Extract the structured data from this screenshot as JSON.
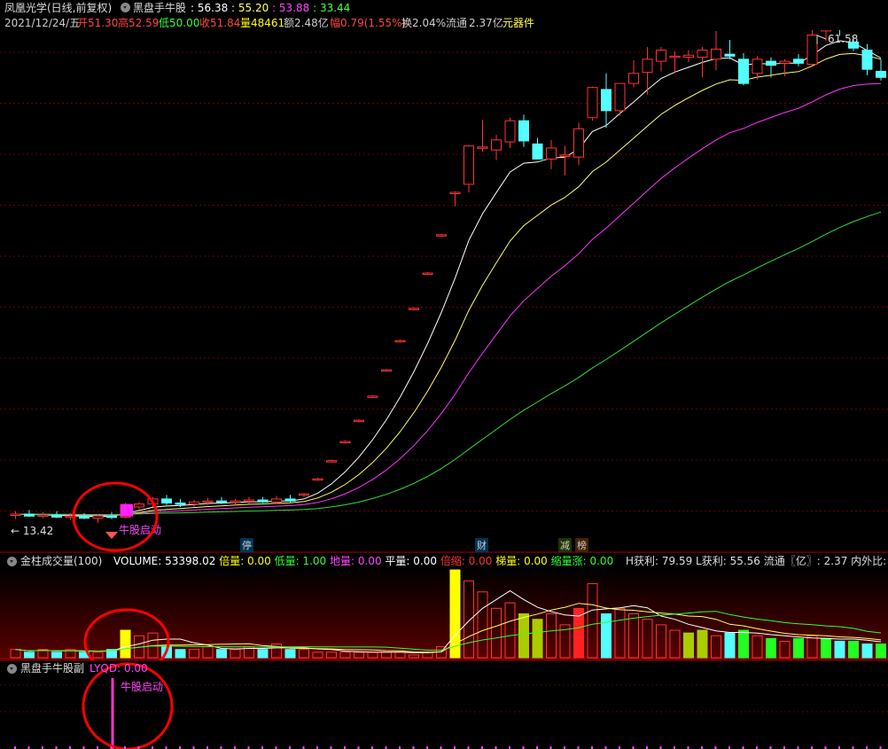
{
  "header": {
    "stock_name": "凤凰光学(日线,前复权)",
    "indicator_name": "黑盘手牛股",
    "ind_values": [
      ": 56.38",
      ": 55.20",
      ": 53.88",
      ": 33.44"
    ],
    "ind_colors": [
      "#ffffff",
      "#ffff66",
      "#ff44ff",
      "#44ff44"
    ],
    "date": "2021/12/24/五",
    "open_label": "开",
    "open": "51.30",
    "high_label": "高",
    "high": "52.59",
    "low_label": "低",
    "low": "50.00",
    "close_label": "收",
    "close": "51.84",
    "vol_label": "量",
    "vol": "48461",
    "amount_label": "额",
    "amount": "2.48亿",
    "change_label": "幅",
    "change": "0.79(1.55%)",
    "turnover_label": "换",
    "turnover": "2.04%",
    "float_label": "流通",
    "float": "2.37亿",
    "sector": "元器件"
  },
  "main_chart": {
    "max_label": "61.58",
    "min_label": "13.42",
    "signal_label": "牛股启动",
    "markers": [
      {
        "text": "停",
        "color": "#66ccff"
      },
      {
        "text": "财",
        "color": "#66ccff"
      },
      {
        "text": "减",
        "color": "#cccc33"
      },
      {
        "text": "榜",
        "color": "#ff8800"
      }
    ]
  },
  "volume_header": {
    "name": "金柱成交量(100)",
    "items": [
      {
        "label": "VOLUME:",
        "value": "53398.02",
        "lc": "#ffffff",
        "vc": "#ffffff"
      },
      {
        "label": "倍量:",
        "value": "0.00",
        "lc": "#ffff00",
        "vc": "#ffff00"
      },
      {
        "label": "低量:",
        "value": "1.00",
        "lc": "#33ff33",
        "vc": "#33ff33"
      },
      {
        "label": "地量:",
        "value": "0.00",
        "lc": "#ff44ff",
        "vc": "#ff44ff"
      },
      {
        "label": "平量:",
        "value": "0.00",
        "lc": "#ffffff",
        "vc": "#ffffff"
      },
      {
        "label": "倍缩:",
        "value": "0.00",
        "lc": "#ff3333",
        "vc": "#ff3333"
      },
      {
        "label": "梯量:",
        "value": "0.00",
        "lc": "#ffff00",
        "vc": "#ffff00"
      },
      {
        "label": "缩量涨:",
        "value": "0.00",
        "lc": "#33ff33",
        "vc": "#33ff33"
      }
    ],
    "right_text": "H获利: 79.59  L获利: 55.56  流通〖亿〗: 2.37  内外比: 1.3"
  },
  "indicator_panel": {
    "name": "黑盘手牛股副",
    "value_label": "LYQD: 0.00",
    "signal_label": "牛股启动"
  },
  "chart_data": {
    "type": "candlestick",
    "ylim": [
      13.42,
      61.58
    ],
    "candles": [
      {
        "o": 14.2,
        "h": 14.6,
        "l": 13.8,
        "c": 14.3
      },
      {
        "o": 14.3,
        "h": 14.7,
        "l": 14.0,
        "c": 14.1
      },
      {
        "o": 14.1,
        "h": 14.5,
        "l": 13.9,
        "c": 14.2
      },
      {
        "o": 14.2,
        "h": 14.6,
        "l": 13.9,
        "c": 14.0
      },
      {
        "o": 14.0,
        "h": 14.4,
        "l": 13.7,
        "c": 14.1
      },
      {
        "o": 14.1,
        "h": 14.4,
        "l": 13.8,
        "c": 13.9
      },
      {
        "o": 13.9,
        "h": 14.3,
        "l": 13.42,
        "c": 14.1
      },
      {
        "o": 14.1,
        "h": 14.5,
        "l": 13.8,
        "c": 14.0
      },
      {
        "o": 14.0,
        "h": 15.4,
        "l": 13.9,
        "c": 15.2
      },
      {
        "o": 15.0,
        "h": 15.5,
        "l": 14.7,
        "c": 15.3
      },
      {
        "o": 15.3,
        "h": 16.0,
        "l": 15.0,
        "c": 15.8
      },
      {
        "o": 15.8,
        "h": 16.2,
        "l": 15.2,
        "c": 15.4
      },
      {
        "o": 15.4,
        "h": 15.8,
        "l": 15.0,
        "c": 15.3
      },
      {
        "o": 15.3,
        "h": 15.7,
        "l": 15.0,
        "c": 15.5
      },
      {
        "o": 15.5,
        "h": 15.9,
        "l": 15.2,
        "c": 15.6
      },
      {
        "o": 15.6,
        "h": 16.0,
        "l": 15.3,
        "c": 15.5
      },
      {
        "o": 15.5,
        "h": 15.8,
        "l": 15.2,
        "c": 15.6
      },
      {
        "o": 15.6,
        "h": 16.0,
        "l": 15.3,
        "c": 15.7
      },
      {
        "o": 15.7,
        "h": 16.0,
        "l": 15.4,
        "c": 15.5
      },
      {
        "o": 15.5,
        "h": 16.1,
        "l": 15.3,
        "c": 15.8
      },
      {
        "o": 15.8,
        "h": 16.2,
        "l": 15.4,
        "c": 15.6
      },
      {
        "o": 16.2,
        "h": 16.4,
        "l": 16.0,
        "c": 16.3
      },
      {
        "o": 17.7,
        "h": 17.9,
        "l": 17.6,
        "c": 17.8
      },
      {
        "o": 19.5,
        "h": 19.7,
        "l": 19.4,
        "c": 19.6
      },
      {
        "o": 21.4,
        "h": 21.6,
        "l": 21.3,
        "c": 21.5
      },
      {
        "o": 23.5,
        "h": 23.7,
        "l": 23.4,
        "c": 23.6
      },
      {
        "o": 25.9,
        "h": 26.1,
        "l": 25.8,
        "c": 26.0
      },
      {
        "o": 28.5,
        "h": 28.7,
        "l": 28.4,
        "c": 28.6
      },
      {
        "o": 31.4,
        "h": 31.6,
        "l": 31.3,
        "c": 31.5
      },
      {
        "o": 34.6,
        "h": 34.8,
        "l": 34.5,
        "c": 34.7
      },
      {
        "o": 38.1,
        "h": 38.3,
        "l": 38.0,
        "c": 38.2
      },
      {
        "o": 41.9,
        "h": 42.1,
        "l": 41.8,
        "c": 42.0
      },
      {
        "o": 46.1,
        "h": 46.3,
        "l": 44.8,
        "c": 46.2
      },
      {
        "o": 47.0,
        "h": 50.9,
        "l": 46.2,
        "c": 50.8
      },
      {
        "o": 50.7,
        "h": 53.4,
        "l": 50.2,
        "c": 50.7
      },
      {
        "o": 50.4,
        "h": 51.9,
        "l": 49.4,
        "c": 51.4
      },
      {
        "o": 51.2,
        "h": 53.6,
        "l": 50.6,
        "c": 53.3
      },
      {
        "o": 53.3,
        "h": 53.9,
        "l": 50.7,
        "c": 51.3
      },
      {
        "o": 51.0,
        "h": 51.6,
        "l": 49.8,
        "c": 49.5
      },
      {
        "o": 49.5,
        "h": 51.4,
        "l": 48.5,
        "c": 50.6
      },
      {
        "o": 49.9,
        "h": 50.8,
        "l": 47.9,
        "c": 49.9
      },
      {
        "o": 49.7,
        "h": 53.1,
        "l": 48.9,
        "c": 52.5
      },
      {
        "o": 53.6,
        "h": 56.7,
        "l": 53.3,
        "c": 56.6
      },
      {
        "o": 56.4,
        "h": 58.0,
        "l": 52.6,
        "c": 54.3
      },
      {
        "o": 54.3,
        "h": 57.0,
        "l": 53.8,
        "c": 57.0
      },
      {
        "o": 57.0,
        "h": 59.3,
        "l": 56.6,
        "c": 58.0
      },
      {
        "o": 58.1,
        "h": 60.6,
        "l": 55.9,
        "c": 59.4
      },
      {
        "o": 59.2,
        "h": 60.6,
        "l": 58.2,
        "c": 60.3
      },
      {
        "o": 59.6,
        "h": 60.2,
        "l": 58.0,
        "c": 59.7
      },
      {
        "o": 59.6,
        "h": 60.3,
        "l": 59.1,
        "c": 59.8
      },
      {
        "o": 59.6,
        "h": 60.6,
        "l": 57.6,
        "c": 60.3
      },
      {
        "o": 59.4,
        "h": 62.2,
        "l": 58.3,
        "c": 60.4
      },
      {
        "o": 59.9,
        "h": 61.3,
        "l": 59.4,
        "c": 59.7
      },
      {
        "o": 59.4,
        "h": 60.0,
        "l": 56.8,
        "c": 57.0
      },
      {
        "o": 58.0,
        "h": 59.7,
        "l": 57.4,
        "c": 59.4
      },
      {
        "o": 59.2,
        "h": 59.6,
        "l": 57.6,
        "c": 58.8
      },
      {
        "o": 59.0,
        "h": 59.4,
        "l": 57.7,
        "c": 59.2
      },
      {
        "o": 59.4,
        "h": 59.9,
        "l": 58.7,
        "c": 59.0
      },
      {
        "o": 58.9,
        "h": 63.5,
        "l": 58.8,
        "c": 61.8
      },
      {
        "o": 62.2,
        "h": 63.5,
        "l": 61.2,
        "c": 63.2
      },
      {
        "o": 63.4,
        "h": 64.1,
        "l": 61.7,
        "c": 62.4
      },
      {
        "o": 61.1,
        "h": 61.6,
        "l": 60.2,
        "c": 60.5
      },
      {
        "o": 60.3,
        "h": 60.9,
        "l": 57.8,
        "c": 58.4
      },
      {
        "o": 58.2,
        "h": 59.4,
        "l": 57.3,
        "c": 57.6
      }
    ],
    "volume": [
      3,
      2,
      3,
      2,
      3,
      2,
      2,
      3,
      10,
      8,
      9,
      4,
      3,
      3,
      4,
      3,
      3,
      4,
      3,
      5,
      3,
      3,
      2,
      2,
      2,
      2,
      2,
      2,
      2,
      1,
      2,
      4,
      32,
      28,
      24,
      18,
      20,
      16,
      14,
      16,
      12,
      18,
      27,
      16,
      18,
      16,
      14,
      12,
      10,
      9,
      10,
      8,
      9,
      10,
      8,
      7,
      6,
      7,
      8,
      7,
      6,
      6,
      5,
      5
    ]
  }
}
